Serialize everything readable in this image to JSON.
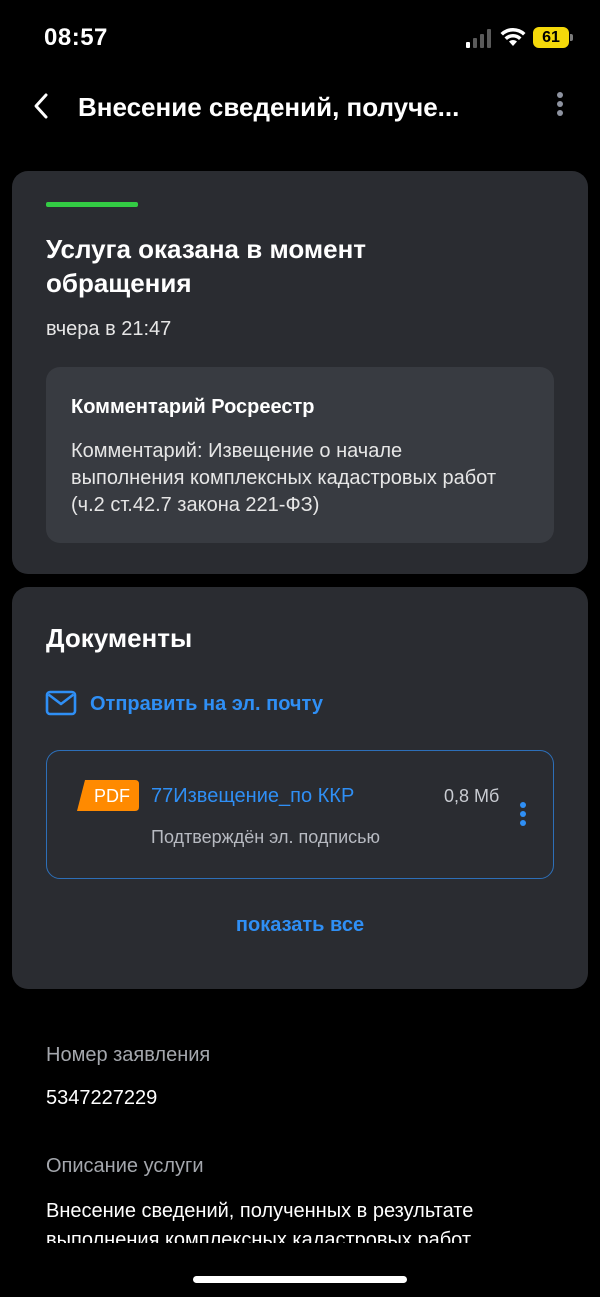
{
  "status_bar": {
    "time": "08:57",
    "battery": "61"
  },
  "nav": {
    "title": "Внесение сведений, получе..."
  },
  "status_card": {
    "status_color": "#33cc44",
    "title": "Услуга оказана в момент обращения",
    "date": "вчера в 21:47",
    "comment": {
      "title": "Комментарий Росреестр",
      "text": "Комментарий: Извещение о начале выполнения комплексных кадастровых работ (ч.2 ст.42.7  закона 221-ФЗ)"
    }
  },
  "documents": {
    "title": "Документы",
    "email_link": "Отправить на эл. почту",
    "items": [
      {
        "badge": "PDF",
        "name": "77Извещение_по ККР",
        "size": "0,8 Мб",
        "signature": "Подтверждён эл. подписью"
      }
    ],
    "show_all": "показать все"
  },
  "details": {
    "application_number_label": "Номер заявления",
    "application_number": "5347227229",
    "description_label": "Описание услуги",
    "description": "Внесение сведений, полученных в результате выполнения комплексных кадастровых работ"
  },
  "colors": {
    "accent": "#2f8ff5",
    "card": "#2a2c31",
    "pdf_badge": "#ff8a00"
  }
}
